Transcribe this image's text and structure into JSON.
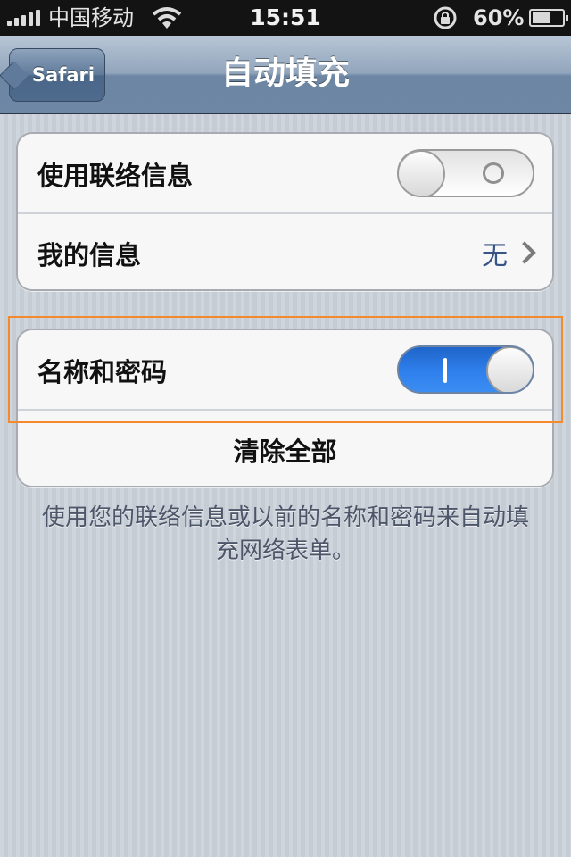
{
  "status_bar": {
    "carrier": "中国移动",
    "time": "15:51",
    "battery_percent": "60%",
    "battery_level": 0.6,
    "signal_icon": "signal-bars-icon",
    "wifi_icon": "wifi-icon",
    "lock_icon": "rotation-lock-icon"
  },
  "nav": {
    "back_label": "Safari",
    "title": "自动填充"
  },
  "group1": {
    "use_contact_info_label": "使用联络信息",
    "use_contact_info_on": false,
    "my_info_label": "我的信息",
    "my_info_value": "无"
  },
  "group2": {
    "names_passwords_label": "名称和密码",
    "names_passwords_on": true,
    "clear_all_label": "清除全部"
  },
  "footnote": "使用您的联络信息或以前的名称和密码来自动填充网络表单。",
  "colors": {
    "switch_on": "#2f80ed",
    "highlight": "#f58a2d",
    "value_text": "#385487"
  }
}
